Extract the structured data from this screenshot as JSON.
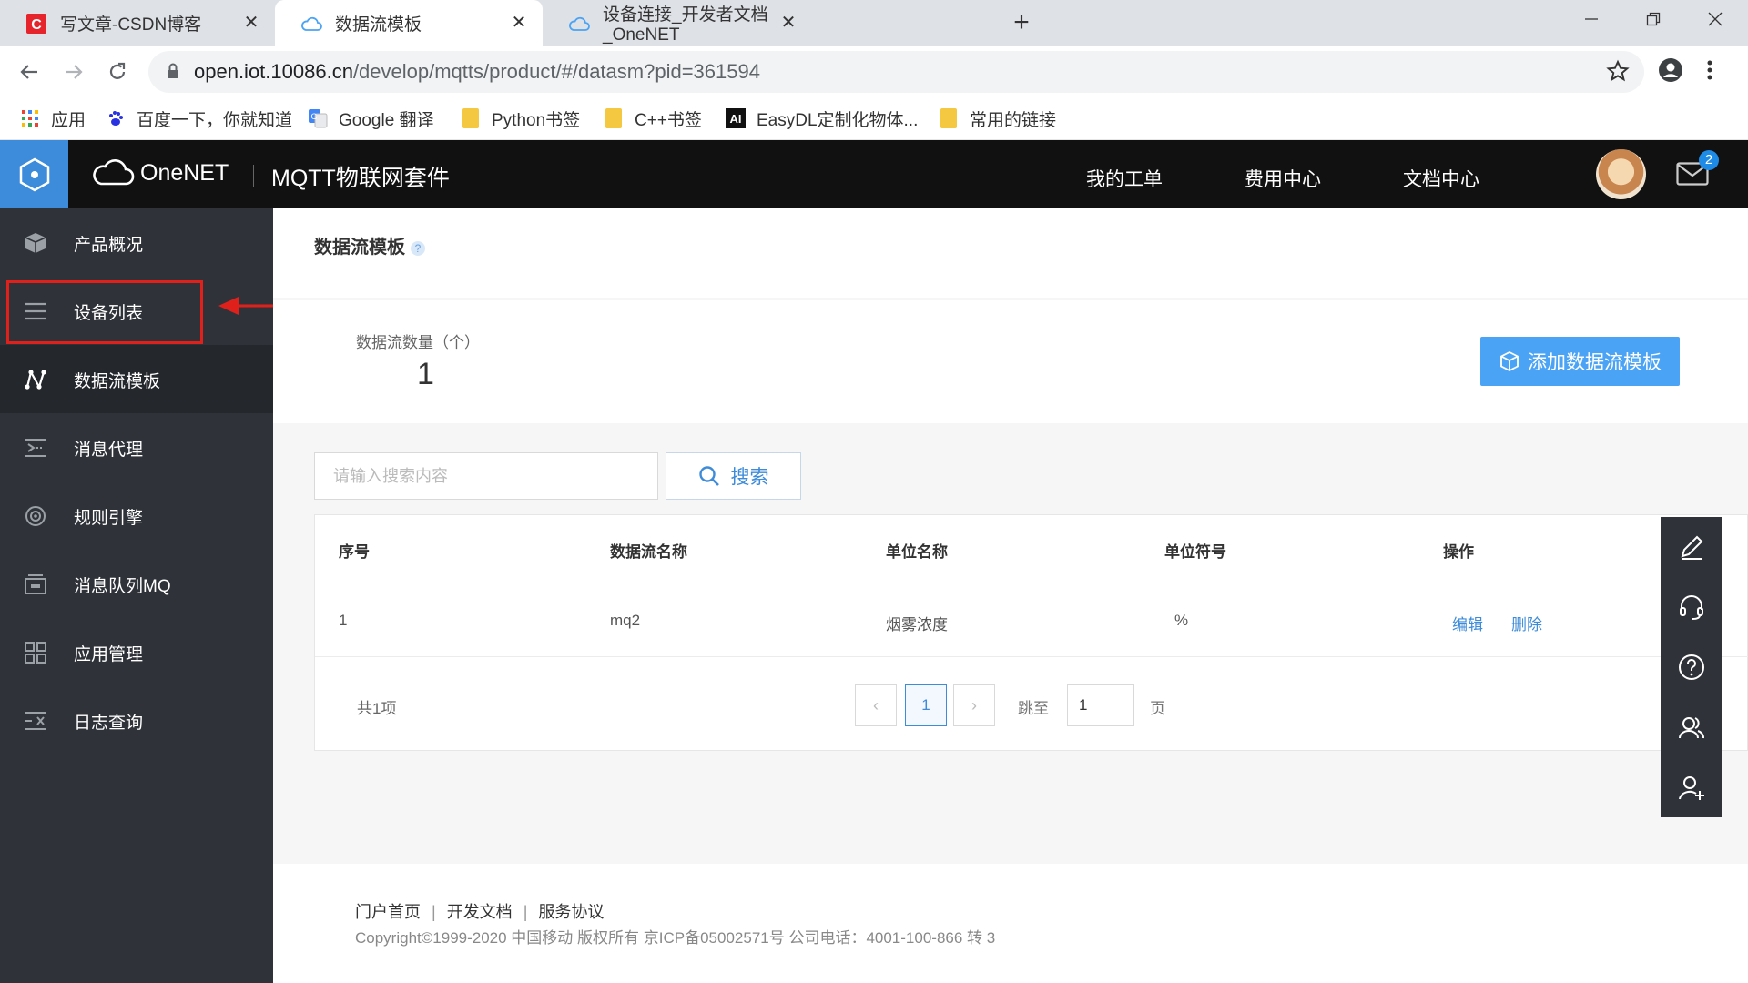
{
  "browser": {
    "tabs": [
      {
        "title": "写文章-CSDN博客",
        "icon": "csdn-icon"
      },
      {
        "title": "数据流模板",
        "icon": "cloud-icon"
      },
      {
        "title": "设备连接_开发者文档_OneNET",
        "icon": "cloud-icon"
      }
    ],
    "url_host": "open.iot.10086.cn",
    "url_path": "/develop/mqtts/product/#/datasm?pid=361594",
    "bookmarks": [
      {
        "label": "应用",
        "icon": "apps-grid-icon"
      },
      {
        "label": "百度一下，你就知道",
        "icon": "baidu-paw-icon"
      },
      {
        "label": "Google 翻译",
        "icon": "google-translate-icon"
      },
      {
        "label": "Python书签",
        "icon": "folder-icon"
      },
      {
        "label": "C++书签",
        "icon": "folder-icon"
      },
      {
        "label": "EasyDL定制化物体...",
        "icon": "ai-icon",
        "icon_text": "AI"
      },
      {
        "label": "常用的链接",
        "icon": "folder-icon"
      }
    ]
  },
  "header": {
    "brand": "OneNET",
    "suite": "MQTT物联网套件",
    "nav": [
      "我的工单",
      "费用中心",
      "文档中心"
    ],
    "mail_count": "2"
  },
  "sidebar": {
    "items": [
      {
        "label": "产品概况",
        "icon": "cube-icon"
      },
      {
        "label": "设备列表",
        "icon": "list-icon"
      },
      {
        "label": "数据流模板",
        "icon": "datastream-icon",
        "active": true
      },
      {
        "label": "消息代理",
        "icon": "message-proxy-icon"
      },
      {
        "label": "规则引擎",
        "icon": "rule-engine-icon"
      },
      {
        "label": "消息队列MQ",
        "icon": "queue-icon"
      },
      {
        "label": "应用管理",
        "icon": "app-grid-icon"
      },
      {
        "label": "日志查询",
        "icon": "log-icon"
      }
    ],
    "highlighted_item": "设备列表",
    "annotation_color": "#e0201b"
  },
  "page": {
    "title": "数据流模板",
    "help": "?",
    "stat_label": "数据流数量（个）",
    "stat_value": "1",
    "add_button": "添加数据流模板",
    "search_placeholder": "请输入搜索内容",
    "search_button": "搜索"
  },
  "table": {
    "headers": [
      "序号",
      "数据流名称",
      "单位名称",
      "单位符号",
      "操作"
    ],
    "rows": [
      {
        "index": "1",
        "name": "mq2",
        "unit_name": "烟雾浓度",
        "unit_symbol": "%",
        "actions": [
          "编辑",
          "删除"
        ]
      }
    ]
  },
  "pagination": {
    "total": "共1项",
    "prev": "‹",
    "current": "1",
    "next": "›",
    "jump_label": "跳至",
    "jump_value": "1",
    "page_unit": "页"
  },
  "floatbar": [
    "edit-icon",
    "headset-icon",
    "help-icon",
    "community-icon",
    "add-user-icon"
  ],
  "footer": {
    "links": [
      "门户首页",
      "开发文档",
      "服务协议"
    ],
    "copyright": "Copyright©1999-2020 中国移动 版权所有 京ICP备05002571号 公司电话：4001-100-866 转 3"
  },
  "colors": {
    "accent": "#3c8cdb",
    "primary_button": "#4aa3f4",
    "sidebar_bg": "#2f3339",
    "header_bg": "#111111"
  }
}
